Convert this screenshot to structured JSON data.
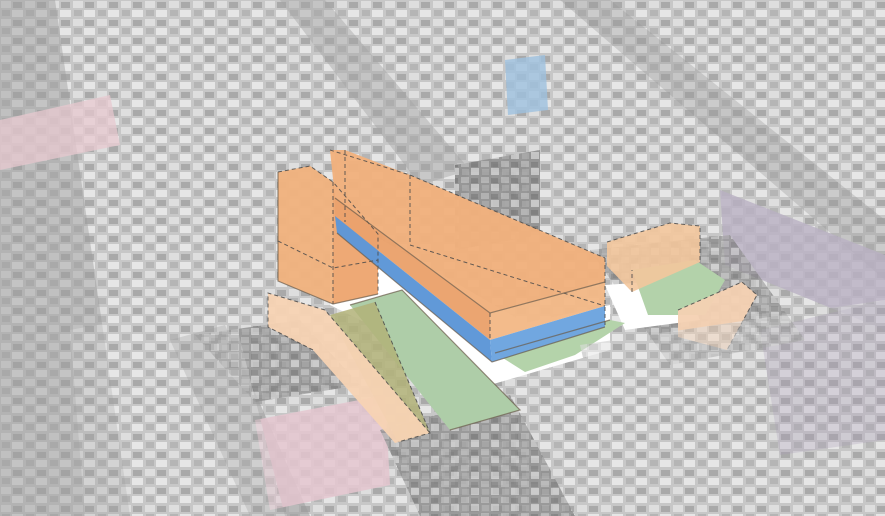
{
  "image": {
    "kind": "aerial-urban-massing-rendering",
    "palette": {
      "context_buildings": "#cfcfcf",
      "context_shadow": "#8e8e8e",
      "street": "#9a9a9a",
      "mass_orange": "#f0b27e",
      "mass_orange_light": "#f7d3b3",
      "mass_blue": "#5e97d7",
      "plaza_white": "#ffffff",
      "green_space": "#aecda8",
      "pink_facade": "#e7c8cf",
      "brick_facade": "#b9b0c3"
    },
    "elements": [
      "background-city-blocks",
      "foreground-building-block",
      "orange-massing-volumes",
      "blue-ground-floor-band",
      "white-pedestrian-area",
      "green-open-spaces",
      "dashed-wireframe-outlines"
    ]
  }
}
